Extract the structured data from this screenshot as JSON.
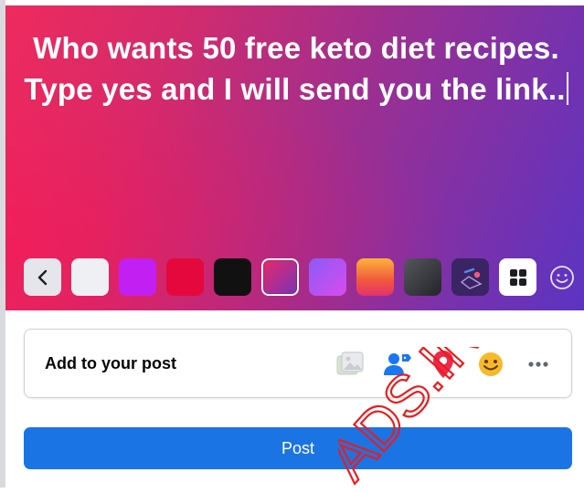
{
  "composer": {
    "post_text": "Who wants 50 free keto diet recipes. Type yes and I will send you the link..",
    "background_gradient": [
      "#ef2a5d",
      "#9a2f93",
      "#5b34c2"
    ]
  },
  "swatches": [
    {
      "name": "white",
      "color": "#eff0f3"
    },
    {
      "name": "purple",
      "color": "#c21ff2"
    },
    {
      "name": "red",
      "color": "#e5083c"
    },
    {
      "name": "black",
      "color": "#111111"
    },
    {
      "name": "gradient-pink-purple",
      "color": "#a12fa0",
      "selected": true
    },
    {
      "name": "gradient-violet",
      "color": "#b25cf2"
    },
    {
      "name": "gradient-orange",
      "color": "#f36b48"
    },
    {
      "name": "gradient-dark",
      "color": "#3a3c42"
    },
    {
      "name": "illustration",
      "color": "#4a2c72"
    }
  ],
  "add_to_post": {
    "label": "Add to your post",
    "icons": [
      "photo-video-icon",
      "tag-people-icon",
      "check-in-location-icon",
      "feeling-activity-icon",
      "more-options-icon"
    ]
  },
  "post_button": {
    "label": "Post",
    "color": "#1b74e4"
  },
  "watermark": {
    "text": "ADS.IN",
    "color": "#e81d1d"
  }
}
